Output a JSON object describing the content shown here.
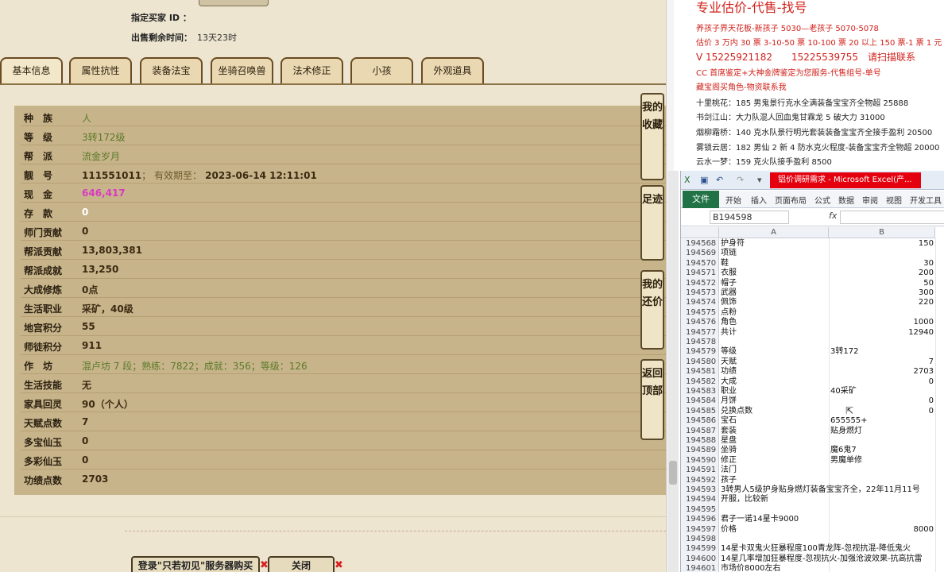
{
  "game": {
    "buyer_label": "指定买家 ID ：",
    "time_label": "出售剩余时间：",
    "time_value": "13天23时",
    "tabs": [
      "基本信息",
      "属性抗性",
      "装备法宝",
      "坐骑召唤兽",
      "法术修正",
      "小孩",
      "外观道具"
    ],
    "rows": [
      {
        "label": "种　族",
        "value": "人",
        "style": "green"
      },
      {
        "label": "等　级",
        "value": "3转172级",
        "style": "green"
      },
      {
        "label": "帮　派",
        "value": "流金岁月",
        "style": "green"
      },
      {
        "label": "靓　号",
        "value": "111551011",
        "extra": "； 有效期至：",
        "extra2": "2023-06-14 12:11:01",
        "style": "bold"
      },
      {
        "label": "现　金",
        "value": "646,417",
        "style": "pink"
      },
      {
        "label": "存　款",
        "value": "0",
        "style": "white"
      },
      {
        "label": "师门贡献",
        "value": "0",
        "style": "bold"
      },
      {
        "label": "帮派贡献",
        "value": "13,803,381",
        "style": "bold"
      },
      {
        "label": "帮派成就",
        "value": "13,250",
        "style": "bold"
      },
      {
        "label": "大成修炼",
        "value": "0点",
        "style": "bold"
      },
      {
        "label": "生活职业",
        "value": "采矿，40级",
        "style": "bold"
      },
      {
        "label": "地宫积分",
        "value": "55",
        "style": "bold"
      },
      {
        "label": "师徒积分",
        "value": "911",
        "style": "bold"
      },
      {
        "label": "作　坊",
        "value": "混卢坊 7 段；熟练：7822；成就：356；等级：126",
        "style": "green"
      },
      {
        "label": "生活技能",
        "value": "无",
        "style": "bold"
      },
      {
        "label": "家具回灵",
        "value": "90（个人）",
        "style": "bold"
      },
      {
        "label": "天赋点数",
        "value": "7",
        "style": "bold"
      },
      {
        "label": "多宝仙玉",
        "value": "0",
        "style": "bold"
      },
      {
        "label": "多彩仙玉",
        "value": "0",
        "style": "bold"
      },
      {
        "label": "功绩点数",
        "value": "2703",
        "style": "bold"
      }
    ],
    "side_buttons": [
      "我的收藏",
      "足迹",
      "我的还价",
      "返回顶部"
    ],
    "bottom_buttons": {
      "login": "登录\"只若初见\"服务器购买",
      "close": "关闭"
    }
  },
  "ads": {
    "headline": "专业估价-代售-找号",
    "line1": "养孩子界天花板-新孩子 5030—老孩子 5070-5078",
    "line2": "估价 3 万内 30 票 3-10-50 票 10-100 票 20 以上 150 票-1 票 1 元",
    "line3": "V 15225921182　　15225539755　请扫描联系",
    "line4": "CC 首席鉴定+大神金牌鉴定为您服务-代售组号-单号",
    "line5": "藏宝阁买角色-物资联系我",
    "deals": [
      {
        "name": "十里桃花：",
        "text": "185 男鬼景行克水全满装备宝宝齐全物超 25888"
      },
      {
        "name": "书剑江山：",
        "text": "大力队混人回血鬼甘霖龙 5 破大力 31000"
      },
      {
        "name": "烟柳霜桥：",
        "text": "140 克水队景行明光套装装备宝宝齐全接手盈利 20500"
      },
      {
        "name": "雾锁云居：",
        "text": "182 男仙 2 新 4 防水克火程度-装备宝宝齐全物超 20000"
      },
      {
        "name": "云水一梦：",
        "text": "159 克火队接手盈利 8500"
      }
    ]
  },
  "excel": {
    "title": "铝价调研需求 - Microsoft Excel(产...",
    "ribbon_tabs": [
      "文件",
      "开始",
      "插入",
      "页面布局",
      "公式",
      "数据",
      "审阅",
      "视图",
      "开发工具"
    ],
    "name_box": "B194598",
    "fx": "fx",
    "col_a": "A",
    "col_b": "B",
    "rows": [
      {
        "n": "194568",
        "a": "护身符",
        "b": "150",
        "num": true
      },
      {
        "n": "194569",
        "a": "项链",
        "b": ""
      },
      {
        "n": "194570",
        "a": "鞋",
        "b": "30",
        "num": true
      },
      {
        "n": "194571",
        "a": "衣服",
        "b": "200",
        "num": true
      },
      {
        "n": "194572",
        "a": "帽子",
        "b": "50",
        "num": true
      },
      {
        "n": "194573",
        "a": "武器",
        "b": "300",
        "num": true
      },
      {
        "n": "194574",
        "a": "佩饰",
        "b": "220",
        "num": true
      },
      {
        "n": "194575",
        "a": "点粉",
        "b": ""
      },
      {
        "n": "194576",
        "a": "角色",
        "b": "1000",
        "num": true
      },
      {
        "n": "194577",
        "a": "共计",
        "b": "12940",
        "num": true
      },
      {
        "n": "194578",
        "a": "",
        "b": ""
      },
      {
        "n": "194579",
        "a": "等级",
        "b": "3转172"
      },
      {
        "n": "194580",
        "a": "天赋",
        "b": "7",
        "num": true
      },
      {
        "n": "194581",
        "a": "功绩",
        "b": "2703",
        "num": true
      },
      {
        "n": "194582",
        "a": "大成",
        "b": "0",
        "num": true
      },
      {
        "n": "194583",
        "a": "职业",
        "b": "40采矿"
      },
      {
        "n": "194584",
        "a": "月饼",
        "b": "0",
        "num": true
      },
      {
        "n": "194585",
        "a": "兑换点数",
        "b": "0",
        "num": true
      },
      {
        "n": "194586",
        "a": "宝石",
        "b": "655555+"
      },
      {
        "n": "194587",
        "a": "套装",
        "b": "贴身燃灯"
      },
      {
        "n": "194588",
        "a": "星盘",
        "b": ""
      },
      {
        "n": "194589",
        "a": "坐骑",
        "b": "魔6鬼7"
      },
      {
        "n": "194590",
        "a": "修正",
        "b": "男魔单修"
      },
      {
        "n": "194591",
        "a": "法门",
        "b": ""
      },
      {
        "n": "194592",
        "a": "孩子",
        "b": ""
      },
      {
        "n": "194593",
        "long": "3转男人5级护身贴身燃灯装备宝宝齐全，22年11月11号"
      },
      {
        "n": "194594",
        "long": "开服，比较新"
      },
      {
        "n": "194595",
        "a": "",
        "b": ""
      },
      {
        "n": "194596",
        "long": "君子一诺14星卡9000"
      },
      {
        "n": "194597",
        "a": "价格",
        "b": "8000",
        "num": true
      },
      {
        "n": "194598",
        "a": "",
        "b": ""
      },
      {
        "n": "194599",
        "long": "14星卡双鬼火狂暴程度100青龙阵-忽视抗混-降低鬼火"
      },
      {
        "n": "194600",
        "long": "14星几率增加狂暴程度-忽视抗火-加强沧波效果-抗高抗雷"
      },
      {
        "n": "194601",
        "long": "市场价8000左右"
      }
    ]
  }
}
